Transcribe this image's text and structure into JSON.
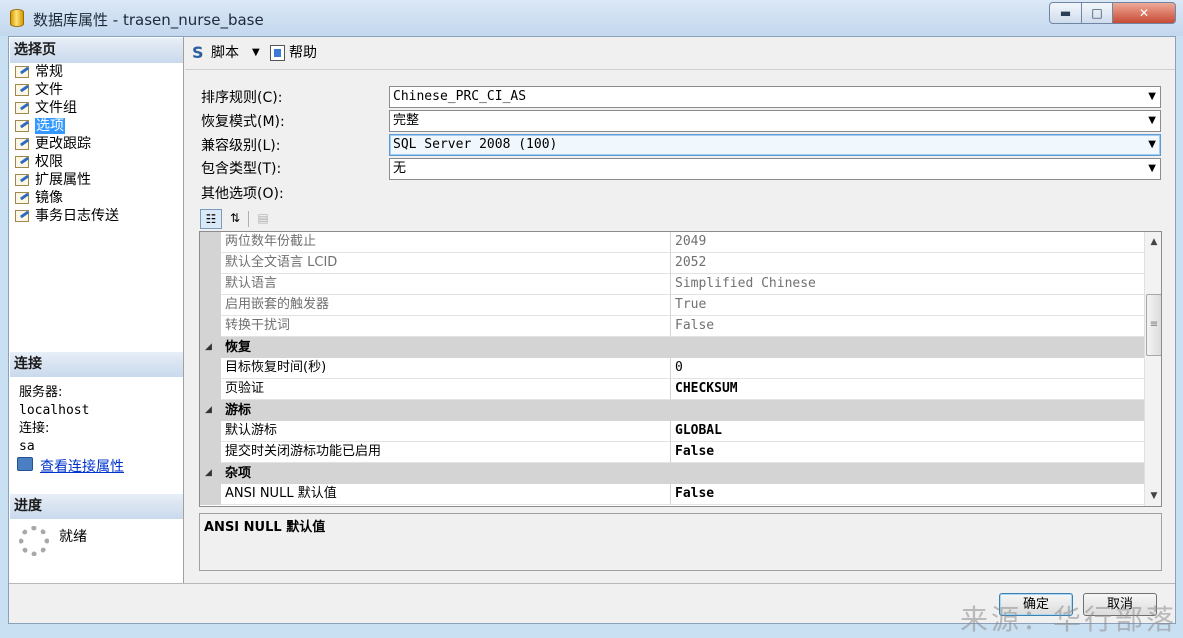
{
  "window": {
    "title": "数据库属性 - trasen_nurse_base",
    "minimize": "▬",
    "maximize": "□",
    "close": "✕"
  },
  "sidebar": {
    "header": "选择页",
    "items": [
      {
        "label": "常规"
      },
      {
        "label": "文件"
      },
      {
        "label": "文件组"
      },
      {
        "label": "选项",
        "selected": true
      },
      {
        "label": "更改跟踪"
      },
      {
        "label": "权限"
      },
      {
        "label": "扩展属性"
      },
      {
        "label": "镜像"
      },
      {
        "label": "事务日志传送"
      }
    ],
    "connection": {
      "header": "连接",
      "server_label": "服务器:",
      "server_value": "localhost",
      "conn_label": "连接:",
      "conn_value": "sa",
      "link": "查看连接属性"
    },
    "progress": {
      "header": "进度",
      "status": "就绪"
    }
  },
  "toolbar": {
    "script_label": "脚本",
    "help_label": "帮助"
  },
  "form": {
    "collation_label": "排序规则(C):",
    "collation_value": "Chinese_PRC_CI_AS",
    "recovery_label": "恢复模式(M):",
    "recovery_value": "完整",
    "compat_label": "兼容级别(L):",
    "compat_value": "SQL Server 2008 (100)",
    "containment_label": "包含类型(T):",
    "containment_value": "无",
    "other_label": "其他选项(O):"
  },
  "grid": {
    "rows": [
      {
        "kind": "prop",
        "name": "两位数年份截止",
        "value": "2049",
        "style": "grey"
      },
      {
        "kind": "prop",
        "name": "默认全文语言 LCID",
        "value": "2052",
        "style": "grey"
      },
      {
        "kind": "prop",
        "name": "默认语言",
        "value": "Simplified Chinese",
        "style": "grey"
      },
      {
        "kind": "prop",
        "name": "启用嵌套的触发器",
        "value": "True",
        "style": "grey"
      },
      {
        "kind": "prop",
        "name": "转换干扰词",
        "value": "False",
        "style": "grey"
      },
      {
        "kind": "cat",
        "name": "恢复"
      },
      {
        "kind": "prop",
        "name": "目标恢复时间(秒)",
        "value": "0",
        "style": "normal"
      },
      {
        "kind": "prop",
        "name": "页验证",
        "value": "CHECKSUM",
        "style": "bold"
      },
      {
        "kind": "cat",
        "name": "游标"
      },
      {
        "kind": "prop",
        "name": "默认游标",
        "value": "GLOBAL",
        "style": "bold"
      },
      {
        "kind": "prop",
        "name": "提交时关闭游标功能已启用",
        "value": "False",
        "style": "bold"
      },
      {
        "kind": "cat",
        "name": "杂项"
      },
      {
        "kind": "prop",
        "name": "ANSI NULL 默认值",
        "value": "False",
        "style": "bold"
      }
    ],
    "description_title": "ANSI NULL 默认值"
  },
  "buttons": {
    "ok": "确定",
    "cancel": "取消"
  },
  "watermark": "来源：华行部落"
}
